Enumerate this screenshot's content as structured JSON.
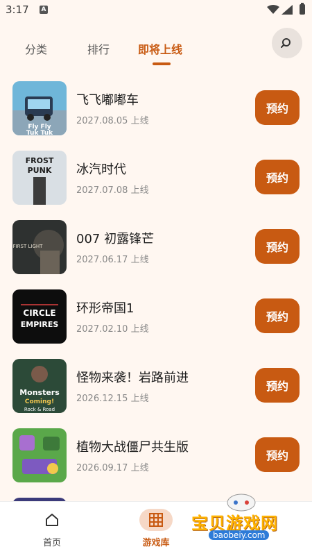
{
  "status": {
    "time": "3:17",
    "app_icon_letter": "A"
  },
  "tabs": [
    {
      "label": "分类"
    },
    {
      "label": "排行"
    },
    {
      "label": "即将上线"
    }
  ],
  "games": [
    {
      "name": "飞飞嘟嘟车",
      "date": "2027.08.05 上线",
      "button": "预约",
      "thumb_text": "Fly Fly Tuk Tuk"
    },
    {
      "name": "冰汽时代",
      "date": "2027.07.08 上线",
      "button": "预约",
      "thumb_text": "FROST PUNK"
    },
    {
      "name": "007 初露锋芒",
      "date": "2027.06.17 上线",
      "button": "预约",
      "thumb_text": "FIRST LIGHT"
    },
    {
      "name": "环形帝国1",
      "date": "2027.02.10 上线",
      "button": "预约",
      "thumb_text": "CIRCLE EMPIRES"
    },
    {
      "name": "怪物来袭！岩路前进",
      "date": "2026.12.15 上线",
      "button": "预约",
      "thumb_text": "Monsters are Coming! Rock & Road"
    },
    {
      "name": "植物大战僵尸共生版",
      "date": "2026.09.17 上线",
      "button": "预约",
      "thumb_text": ""
    }
  ],
  "bottom_nav": [
    {
      "label": "首页"
    },
    {
      "label": "游戏库"
    }
  ],
  "watermark": {
    "text": "宝贝游戏网",
    "url": "baobeiy.com"
  },
  "colors": {
    "accent": "#c85a12",
    "background": "#fff7f1"
  }
}
